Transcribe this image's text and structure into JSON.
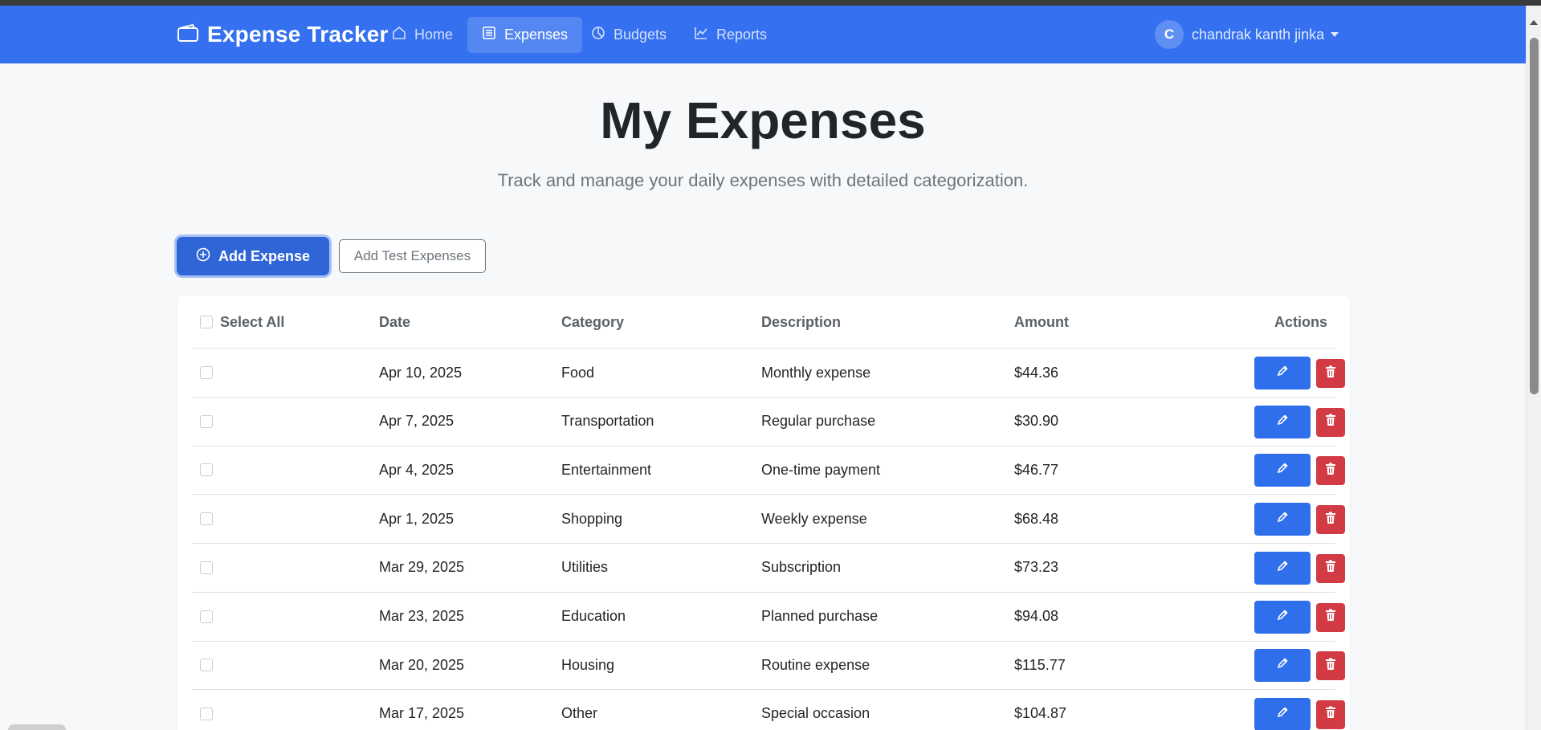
{
  "app": {
    "brand_icon": "wallet-icon",
    "title": "Expense Tracker"
  },
  "nav": {
    "items": [
      {
        "label": "Home",
        "icon": "home-icon"
      },
      {
        "label": "Expenses",
        "icon": "list-icon",
        "active": true
      },
      {
        "label": "Budgets",
        "icon": "pie-chart-icon"
      },
      {
        "label": "Reports",
        "icon": "line-chart-icon"
      }
    ]
  },
  "user": {
    "initial": "C",
    "name": "chandrak kanth jinka"
  },
  "page": {
    "title": "My Expenses",
    "subtitle": "Track and manage your daily expenses with detailed categorization."
  },
  "actions": {
    "add_expense": "Add Expense",
    "add_test_expenses": "Add Test Expenses"
  },
  "table": {
    "columns": {
      "select_all": "Select All",
      "date": "Date",
      "category": "Category",
      "description": "Description",
      "amount": "Amount",
      "actions": "Actions"
    },
    "rows": [
      {
        "date": "Apr 10, 2025",
        "category": "Food",
        "description": "Monthly expense",
        "amount": "$44.36"
      },
      {
        "date": "Apr 7, 2025",
        "category": "Transportation",
        "description": "Regular purchase",
        "amount": "$30.90"
      },
      {
        "date": "Apr 4, 2025",
        "category": "Entertainment",
        "description": "One-time payment",
        "amount": "$46.77"
      },
      {
        "date": "Apr 1, 2025",
        "category": "Shopping",
        "description": "Weekly expense",
        "amount": "$68.48"
      },
      {
        "date": "Mar 29, 2025",
        "category": "Utilities",
        "description": "Subscription",
        "amount": "$73.23"
      },
      {
        "date": "Mar 23, 2025",
        "category": "Education",
        "description": "Planned purchase",
        "amount": "$94.08"
      },
      {
        "date": "Mar 20, 2025",
        "category": "Housing",
        "description": "Routine expense",
        "amount": "$115.77"
      },
      {
        "date": "Mar 17, 2025",
        "category": "Other",
        "description": "Special occasion",
        "amount": "$104.87"
      }
    ]
  },
  "colors": {
    "navbar": "#3470f0",
    "primary": "#2f65d6",
    "edit": "#2f6fec",
    "delete": "#d23a44"
  }
}
